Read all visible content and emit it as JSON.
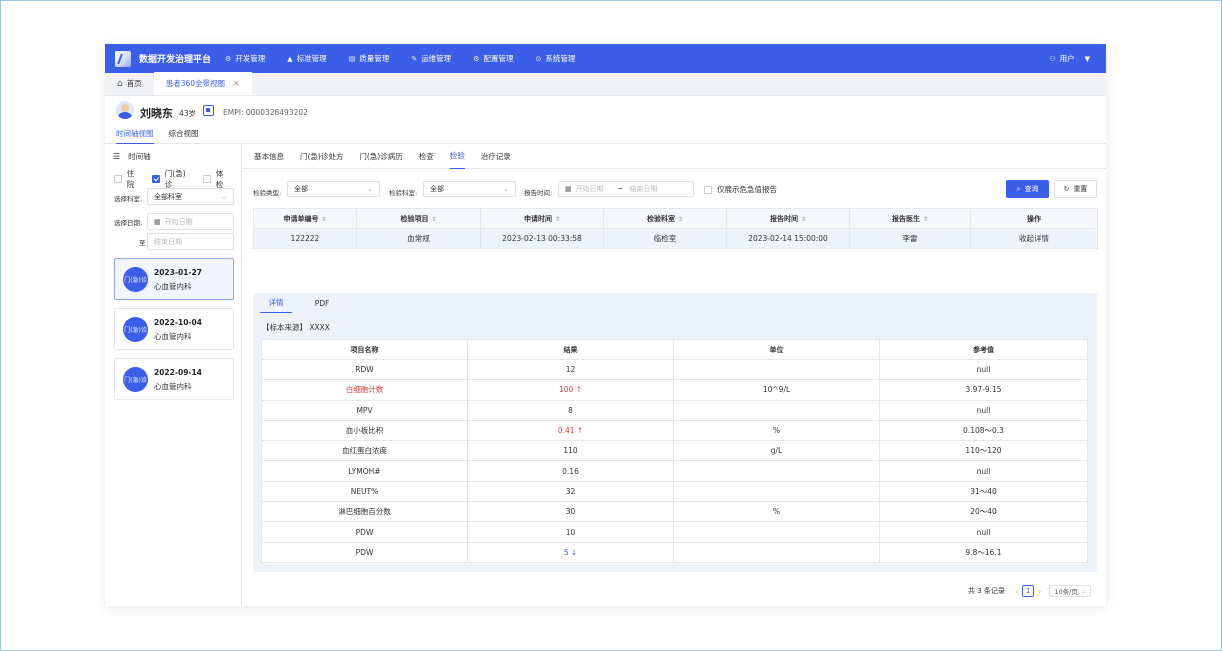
{
  "app": {
    "title": "数据开发治理平台",
    "nav": [
      {
        "icon": "dev-icon",
        "glyph": "⚙",
        "label": "开发管理"
      },
      {
        "icon": "standard-icon",
        "glyph": "▲",
        "label": "标准管理"
      },
      {
        "icon": "quality-icon",
        "glyph": "▤",
        "label": "质量管理"
      },
      {
        "icon": "ops-icon",
        "glyph": "✎",
        "label": "运维管理"
      },
      {
        "icon": "config-icon",
        "glyph": "⚙",
        "label": "配置管理"
      },
      {
        "icon": "system-icon",
        "glyph": "⊙",
        "label": "系统管理"
      }
    ],
    "user": "用户"
  },
  "tabs": {
    "home": "首页",
    "current": "患者360全景视图"
  },
  "patient": {
    "name": "刘晓东",
    "age": "43岁",
    "empi_label": "EMPI:",
    "empi": "0000328493202",
    "views": [
      "时间轴视图",
      "综合视图"
    ]
  },
  "timeline": {
    "title": "时间轴",
    "filters": [
      {
        "label": "住院",
        "checked": false
      },
      {
        "label": "门(急)诊",
        "checked": true
      },
      {
        "label": "体检",
        "checked": false
      }
    ],
    "dept_label": "选择科室:",
    "dept_value": "全部科室",
    "date_label": "选择日期:",
    "date_start_placeholder": "开始日期",
    "date_to": "至",
    "date_end_placeholder": "结束日期",
    "visits": [
      {
        "badge": "门(急)诊",
        "date": "2023-01-27",
        "dept": "心血管内科"
      },
      {
        "badge": "门(急)诊",
        "date": "2022-10-04",
        "dept": "心血管内科"
      },
      {
        "badge": "门(急)诊",
        "date": "2022-09-14",
        "dept": "心血管内科"
      }
    ]
  },
  "subtabs": [
    "基本信息",
    "门(急)诊处方",
    "门(急)诊病历",
    "检查",
    "检验",
    "治疗记录"
  ],
  "query": {
    "type_label": "检验类型:",
    "type_value": "全部",
    "dept_label": "检验科室:",
    "dept_value": "全部",
    "time_label": "报告时间:",
    "start_placeholder": "开始日期",
    "end_placeholder": "结束日期",
    "critical_only": "仅展示危急值报告",
    "search_btn": "查询",
    "reset_btn": "重置"
  },
  "lab_table": {
    "headers": [
      "申请单编号",
      "检验项目",
      "申请时间",
      "检验科室",
      "报告时间",
      "报告医生",
      "操作"
    ],
    "rows": [
      [
        "122222",
        "血常规",
        "2023-02-13 00:33:58",
        "临检室",
        "2023-02-14 15:00:00",
        "李雷",
        "收起详情"
      ]
    ]
  },
  "detail": {
    "tabs": [
      "详情",
      "PDF"
    ],
    "sample_source": "【标本来源】 XXXX",
    "headers": [
      "项目名称",
      "结果",
      "单位",
      "参考值"
    ],
    "rows": [
      {
        "name": "RDW",
        "result": "12",
        "flag": "",
        "unit": "",
        "ref": "null"
      },
      {
        "name": "白细胞计数",
        "result": "100",
        "flag": "high",
        "unit": "10^9/L",
        "ref": "3.97-9.15"
      },
      {
        "name": "MPV",
        "result": "8",
        "flag": "",
        "unit": "",
        "ref": "null"
      },
      {
        "name": "血小板比积",
        "result": "0.41",
        "flag": "high",
        "unit": "%",
        "ref": "0.108～0.3"
      },
      {
        "name": "血红蛋白浓度",
        "result": "110",
        "flag": "",
        "unit": "g/L",
        "ref": "110～120"
      },
      {
        "name": "LYMOH#",
        "result": "0.16",
        "flag": "",
        "unit": "",
        "ref": "null"
      },
      {
        "name": "NEUT%",
        "result": "32",
        "flag": "",
        "unit": "",
        "ref": "31～40"
      },
      {
        "name": "淋巴细胞百分数",
        "result": "30",
        "flag": "",
        "unit": "%",
        "ref": "20～40"
      },
      {
        "name": "PDW",
        "result": "10",
        "flag": "",
        "unit": "",
        "ref": "null"
      },
      {
        "name": "PDW",
        "result": "5",
        "flag": "low",
        "unit": "",
        "ref": "9.8～16.1"
      }
    ]
  },
  "pagination": {
    "total": "共 3 条记录",
    "page": "1",
    "page_size": "10条/页"
  },
  "colors": {
    "primary": "#3b5ee8",
    "high": "#e53935",
    "row_bg": "#eef2fa"
  }
}
